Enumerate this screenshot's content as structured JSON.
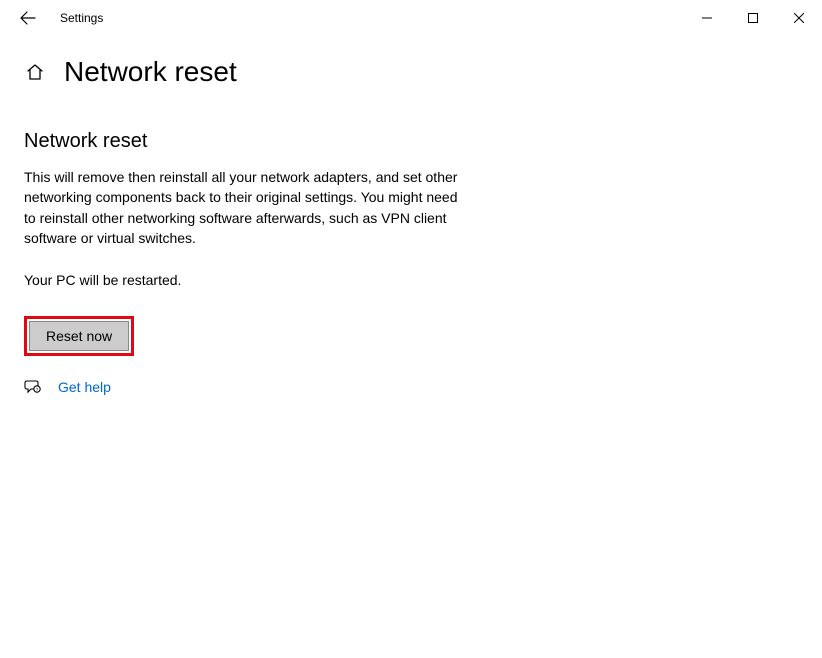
{
  "titlebar": {
    "app_name": "Settings"
  },
  "header": {
    "page_title": "Network reset"
  },
  "main": {
    "section_heading": "Network reset",
    "description": "This will remove then reinstall all your network adapters, and set other networking components back to their original settings. You might need to reinstall other networking software afterwards, such as VPN client software or virtual switches.",
    "restart_note": "Your PC will be restarted.",
    "reset_button_label": "Reset now",
    "help_link_label": "Get help"
  },
  "colors": {
    "highlight_border": "#e30613",
    "link": "#0066cc",
    "button_bg": "#cccccc"
  }
}
